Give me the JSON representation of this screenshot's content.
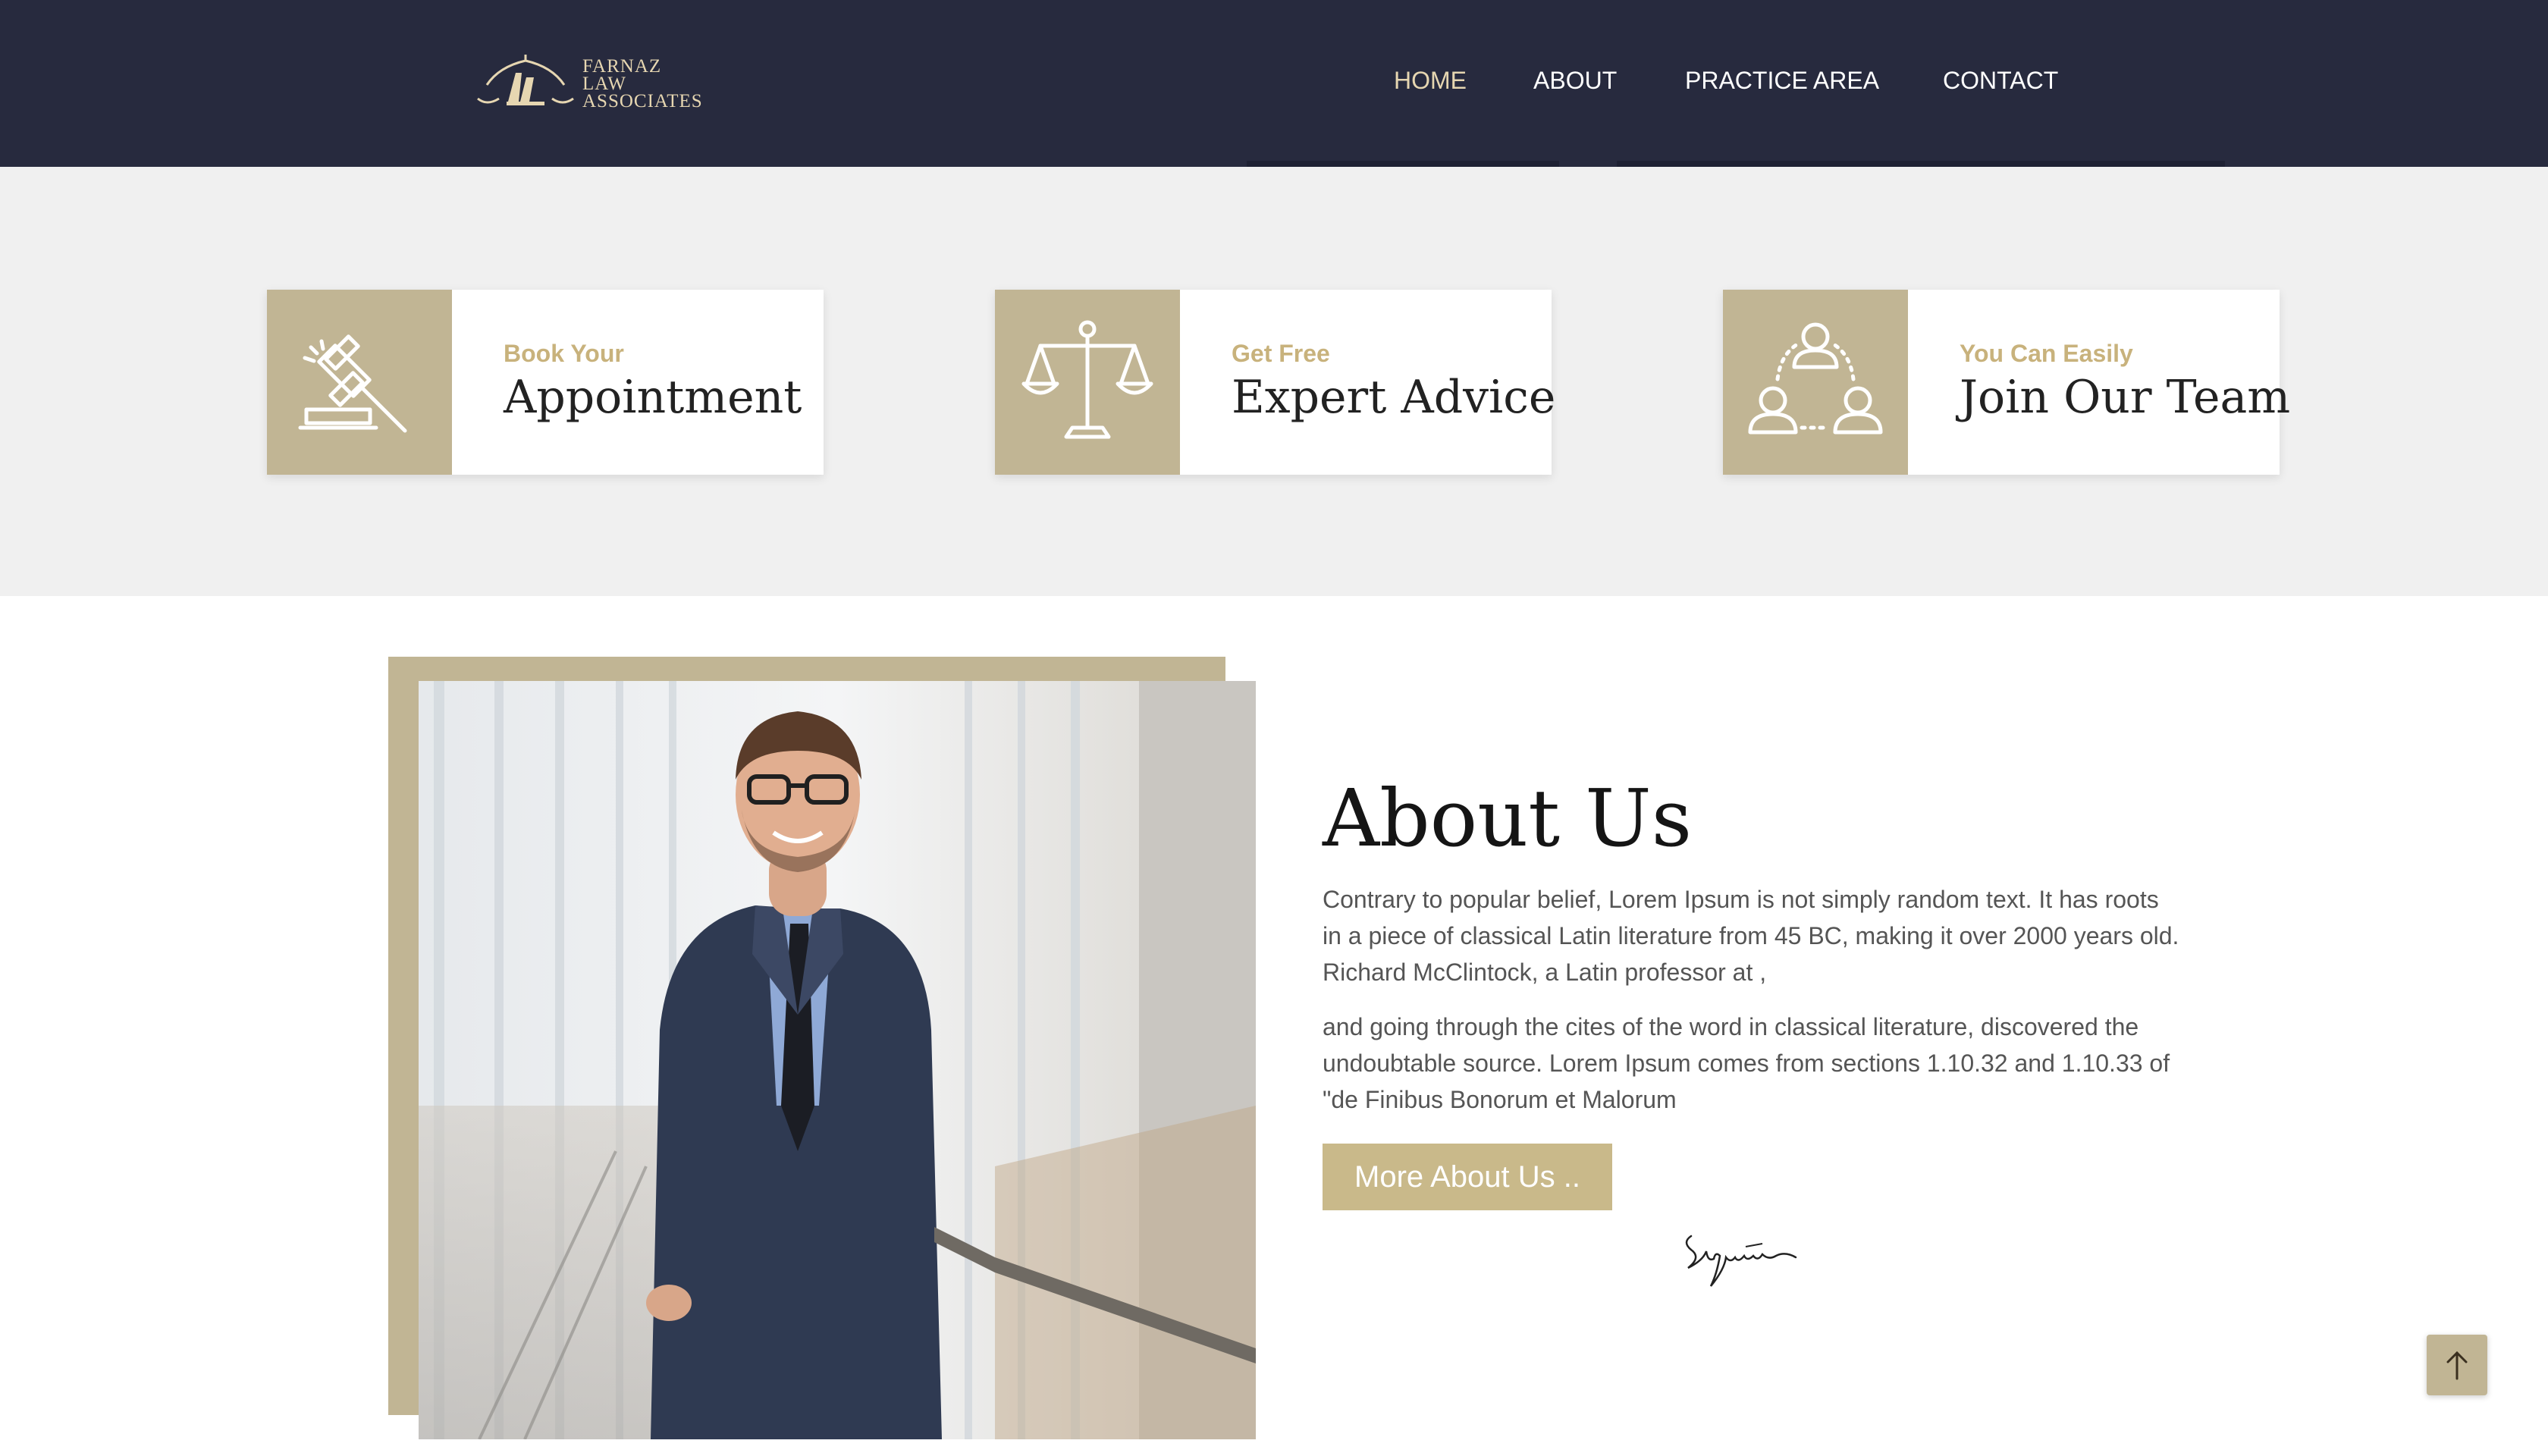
{
  "header": {
    "logo_lines": [
      "FARNAZ",
      "LAW",
      "ASSOCIATES"
    ],
    "nav": [
      {
        "label": "HOME",
        "active": true
      },
      {
        "label": "ABOUT",
        "active": false
      },
      {
        "label": "PRACTICE AREA",
        "active": false
      },
      {
        "label": "CONTACT",
        "active": false
      }
    ]
  },
  "features": [
    {
      "icon": "gavel-icon",
      "subtitle": "Book Your",
      "title": "Appointment"
    },
    {
      "icon": "scales-icon",
      "subtitle": "Get Free",
      "title": "Expert Advice"
    },
    {
      "icon": "team-icon",
      "subtitle": "You Can Easily",
      "title": "Join Our Team"
    }
  ],
  "about": {
    "title": "About Us",
    "paragraph1": "Contrary to popular belief, Lorem Ipsum is not simply random text. It has roots in a piece of classical Latin literature from 45 BC, making it over 2000 years old. Richard McClintock, a Latin professor at ,",
    "paragraph2": "and going through the cites of the word in classical literature, discovered the undoubtable source. Lorem Ipsum comes from sections 1.10.32 and 1.10.33 of \"de Finibus Bonorum et Malorum",
    "button_label": "More About Us ..",
    "signature_text": "Signature"
  },
  "colors": {
    "header_bg": "#272a3e",
    "accent_gold": "#c1b594",
    "accent_text": "#e6d6b1",
    "band_bg": "#f0f0f0"
  },
  "scroll_top_icon": "arrow-up-icon"
}
